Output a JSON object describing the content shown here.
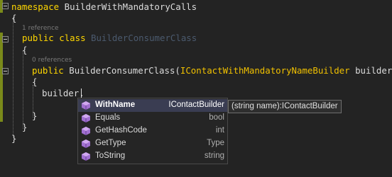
{
  "colors": {
    "background": "#232323",
    "keyword": "#ffd700",
    "selection": "#3a3d52",
    "change_bar": "#7a8a1a"
  },
  "code": {
    "line1": {
      "keyword": "namespace",
      "name": "BuilderWithMandatoryCalls"
    },
    "line2": {
      "text": "{"
    },
    "ref1": "1 reference",
    "line3": {
      "kw1": "public",
      "kw2": "class",
      "name": "BuilderConsumerClass"
    },
    "line4": {
      "text": "{"
    },
    "ref2": "0 references",
    "line5": {
      "kw": "public",
      "name": "BuilderConsumerClass(",
      "iface": "IContactWithMandatoryNameBuilder",
      "rest": " builder )"
    },
    "line6": {
      "text": "{"
    },
    "line7": {
      "text": "builder."
    },
    "line8": {
      "text": "}"
    },
    "line9": {
      "text": "}"
    },
    "line10": {
      "text": "}"
    }
  },
  "completion": {
    "items": [
      {
        "name": "WithName",
        "type": "IContactBuilder",
        "icon": "method-icon"
      },
      {
        "name": "Equals",
        "type": "bool",
        "icon": "method-icon"
      },
      {
        "name": "GetHashCode",
        "type": "int",
        "icon": "method-icon"
      },
      {
        "name": "GetType",
        "type": "Type",
        "icon": "method-icon"
      },
      {
        "name": "ToString",
        "type": "string",
        "icon": "method-icon"
      }
    ],
    "tooltip": "(string name):IContactBuilder"
  }
}
